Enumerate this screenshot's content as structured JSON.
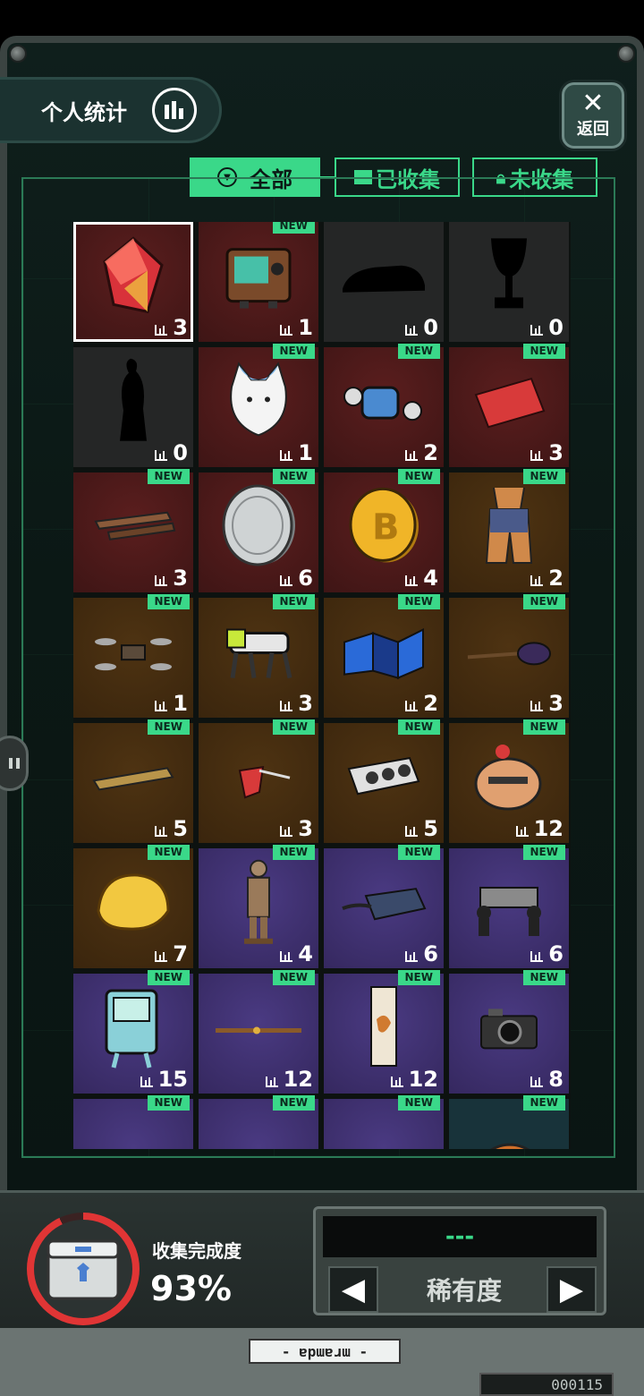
{
  "header": {
    "stats_label": "个人统计",
    "back_label": "返回",
    "back_symbol": "✕"
  },
  "tabs": [
    {
      "label": "全部",
      "active": true,
      "icon": "filter-icon"
    },
    {
      "label": "已收集",
      "active": false,
      "icon": "card-icon"
    },
    {
      "label": "未收集",
      "active": false,
      "icon": "lock-icon"
    }
  ],
  "new_badge": "NEW",
  "items": [
    {
      "count": "3",
      "new": false,
      "bg": "red",
      "selected": true,
      "icon": "crystal-icon"
    },
    {
      "count": "1",
      "new": true,
      "bg": "red",
      "icon": "retro-tv-icon"
    },
    {
      "count": "0",
      "new": false,
      "bg": "grey",
      "icon": "car-silhouette-icon"
    },
    {
      "count": "0",
      "new": false,
      "bg": "grey",
      "icon": "trophy-silhouette-icon"
    },
    {
      "count": "0",
      "new": false,
      "bg": "grey",
      "icon": "statue-silhouette-icon"
    },
    {
      "count": "1",
      "new": true,
      "bg": "red",
      "icon": "cat-plush-icon"
    },
    {
      "count": "2",
      "new": true,
      "bg": "red",
      "icon": "robot-toy-icon"
    },
    {
      "count": "3",
      "new": true,
      "bg": "red",
      "icon": "ticket-card-icon"
    },
    {
      "count": "3",
      "new": true,
      "bg": "red",
      "icon": "wood-sticks-icon"
    },
    {
      "count": "6",
      "new": true,
      "bg": "red",
      "icon": "silver-coin-icon"
    },
    {
      "count": "4",
      "new": true,
      "bg": "red",
      "icon": "bitcoin-icon"
    },
    {
      "count": "2",
      "new": true,
      "bg": "brown",
      "icon": "overalls-icon"
    },
    {
      "count": "1",
      "new": true,
      "bg": "brown",
      "icon": "drone-icon"
    },
    {
      "count": "3",
      "new": true,
      "bg": "brown",
      "icon": "robot-dog-icon"
    },
    {
      "count": "2",
      "new": true,
      "bg": "brown",
      "icon": "star-map-icon"
    },
    {
      "count": "3",
      "new": true,
      "bg": "brown",
      "icon": "guitar-icon"
    },
    {
      "count": "5",
      "new": true,
      "bg": "brown",
      "icon": "phone-icon"
    },
    {
      "count": "3",
      "new": true,
      "bg": "brown",
      "icon": "ruby-pin-icon"
    },
    {
      "count": "5",
      "new": true,
      "bg": "brown",
      "icon": "gpu-card-icon"
    },
    {
      "count": "12",
      "new": true,
      "bg": "brown",
      "icon": "bean-bag-icon"
    },
    {
      "count": "7",
      "new": true,
      "bg": "brown",
      "icon": "cheese-icon"
    },
    {
      "count": "4",
      "new": true,
      "bg": "purple",
      "icon": "terracotta-warrior-icon"
    },
    {
      "count": "6",
      "new": true,
      "bg": "purple",
      "icon": "vr-device-icon"
    },
    {
      "count": "6",
      "new": true,
      "bg": "purple",
      "icon": "pallbearers-icon"
    },
    {
      "count": "15",
      "new": true,
      "bg": "purple",
      "icon": "bmo-robot-icon"
    },
    {
      "count": "12",
      "new": true,
      "bg": "purple",
      "icon": "staff-icon"
    },
    {
      "count": "12",
      "new": true,
      "bg": "purple",
      "icon": "tiger-scroll-icon"
    },
    {
      "count": "8",
      "new": true,
      "bg": "purple",
      "icon": "camera-icon"
    },
    {
      "count": "",
      "new": true,
      "bg": "purple",
      "icon": "partial-item-icon"
    },
    {
      "count": "",
      "new": true,
      "bg": "purple",
      "icon": "partial-item-icon"
    },
    {
      "count": "",
      "new": true,
      "bg": "purple",
      "icon": "partial-item-icon"
    },
    {
      "count": "",
      "new": true,
      "bg": "teal",
      "icon": "basketball-icon"
    }
  ],
  "progress": {
    "label": "收集完成度",
    "value": "93%",
    "fraction": 0.93
  },
  "sort": {
    "display": "---",
    "label": "稀有度",
    "prev_symbol": "◀",
    "next_symbol": "▶"
  },
  "footer": {
    "plate": "- ɐpɯɐɹɯ -",
    "code": "000115"
  },
  "colors": {
    "accent": "#3ad889",
    "progress_ring": "#e03535",
    "rarity_red": "#3e1515",
    "rarity_brown": "#3a250d",
    "rarity_purple": "#35285f"
  }
}
